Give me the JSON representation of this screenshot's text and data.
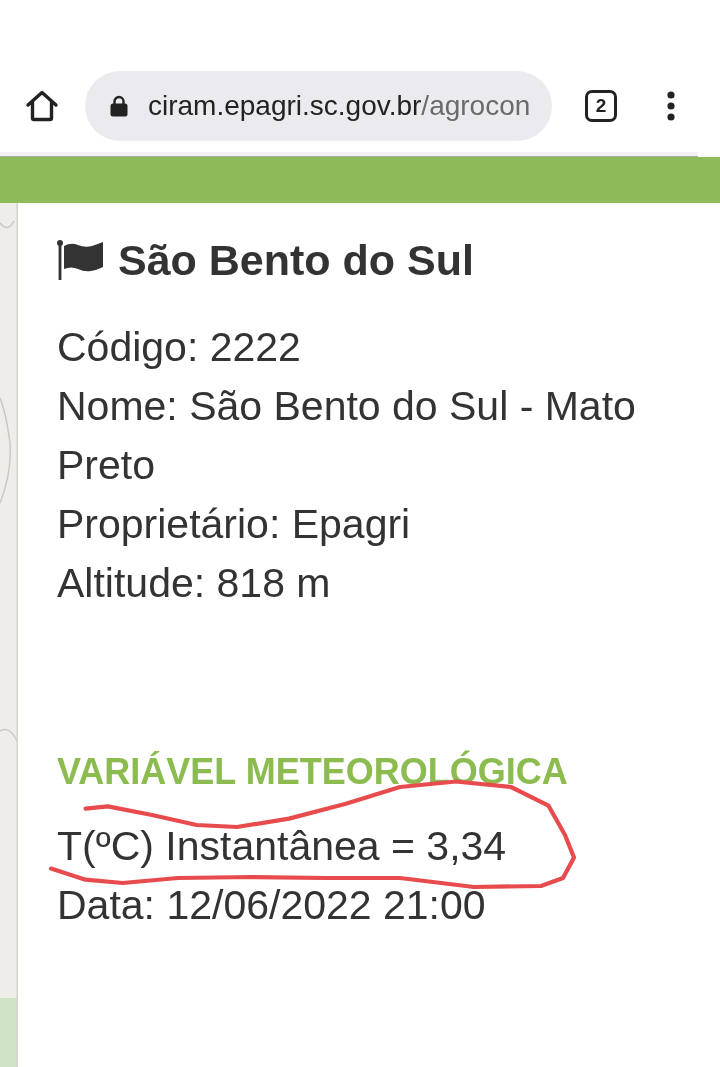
{
  "browser": {
    "url_host": "ciram.epagri.sc.gov.br",
    "url_path": "/agrocon",
    "tab_count": "2"
  },
  "station": {
    "title": "São Bento do Sul",
    "details": [
      "Código: 2222",
      "Nome: São Bento do Sul - Mato Preto",
      "Proprietário: Epagri",
      "Altitude: 818 m"
    ]
  },
  "variable": {
    "heading": "VARIÁVEL METEOROLÓGICA",
    "lines": [
      {
        "text": "T(ºC) Instantânea = 3,34",
        "circled": true
      },
      {
        "text": "Data: 12/06/2022 21:00",
        "circled": false
      }
    ]
  }
}
